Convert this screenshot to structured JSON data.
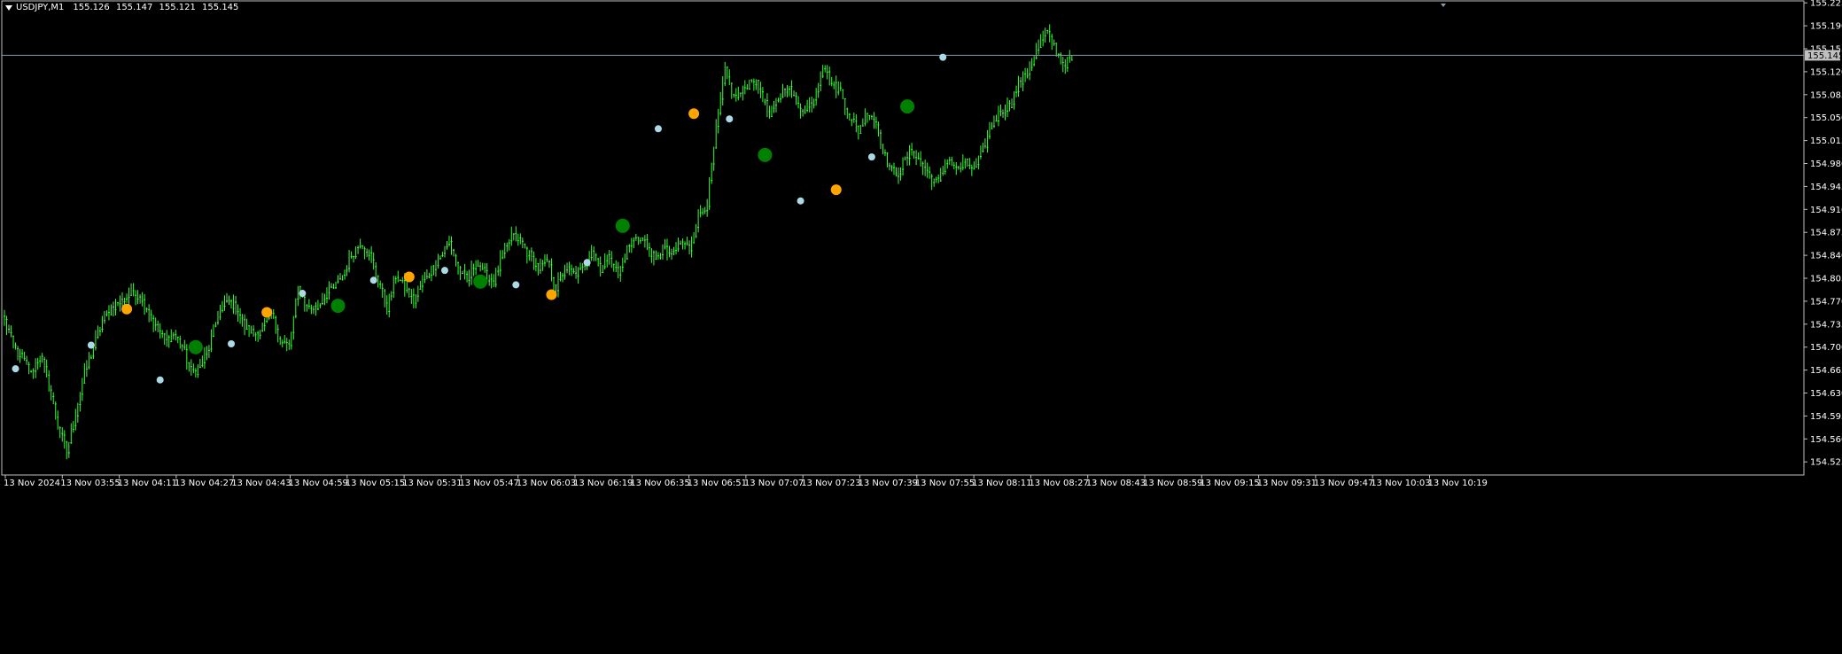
{
  "window": {
    "symbol_timeframe": "USDJPY,M1",
    "ohlc": [
      "155.126",
      "155.147",
      "155.121",
      "155.145"
    ]
  },
  "colors": {
    "background": "#000000",
    "candle": "#33ff33",
    "grid_frame": "#c0c0c0",
    "price_line": "#8899aa",
    "dot_light_blue": "#add8e6",
    "dot_orange": "#ffa500",
    "dot_green": "#008000"
  },
  "chart_data": {
    "type": "candlestick",
    "title": "",
    "xlabel": "",
    "ylabel": "",
    "ylim": [
      154.505,
      155.228
    ],
    "y_ticks": [
      "155.225",
      "155.190",
      "155.155",
      "155.120",
      "155.085",
      "155.050",
      "155.015",
      "154.980",
      "154.945",
      "154.910",
      "154.875",
      "154.840",
      "154.805",
      "154.770",
      "154.735",
      "154.700",
      "154.665",
      "154.630",
      "154.595",
      "154.560",
      "154.525"
    ],
    "current_price": "155.145",
    "x_ticks": [
      "13 Nov 2024",
      "13 Nov 03:55",
      "13 Nov 04:11",
      "13 Nov 04:27",
      "13 Nov 04:43",
      "13 Nov 04:59",
      "13 Nov 05:15",
      "13 Nov 05:31",
      "13 Nov 05:47",
      "13 Nov 06:03",
      "13 Nov 06:19",
      "13 Nov 06:35",
      "13 Nov 06:51",
      "13 Nov 07:07",
      "13 Nov 07:23",
      "13 Nov 07:39",
      "13 Nov 07:55",
      "13 Nov 08:11",
      "13 Nov 08:27",
      "13 Nov 08:43",
      "13 Nov 08:59",
      "13 Nov 09:15",
      "13 Nov 09:31",
      "13 Nov 09:47",
      "13 Nov 10:03",
      "13 Nov 10:19"
    ],
    "close_path": [
      [
        0,
        154.74
      ],
      [
        4,
        154.7
      ],
      [
        8,
        154.68
      ],
      [
        12,
        154.66
      ],
      [
        16,
        154.69
      ],
      [
        20,
        154.64
      ],
      [
        24,
        154.58
      ],
      [
        28,
        154.54
      ],
      [
        32,
        154.6
      ],
      [
        36,
        154.66
      ],
      [
        40,
        154.7
      ],
      [
        44,
        154.74
      ],
      [
        48,
        154.76
      ],
      [
        52,
        154.77
      ],
      [
        56,
        154.78
      ],
      [
        60,
        154.78
      ],
      [
        64,
        154.76
      ],
      [
        68,
        154.73
      ],
      [
        72,
        154.71
      ],
      [
        76,
        154.72
      ],
      [
        80,
        154.7
      ],
      [
        84,
        154.66
      ],
      [
        88,
        154.67
      ],
      [
        92,
        154.7
      ],
      [
        96,
        154.75
      ],
      [
        100,
        154.77
      ],
      [
        104,
        154.76
      ],
      [
        108,
        154.73
      ],
      [
        112,
        154.72
      ],
      [
        116,
        154.73
      ],
      [
        120,
        154.75
      ],
      [
        124,
        154.71
      ],
      [
        128,
        154.7
      ],
      [
        132,
        154.79
      ],
      [
        136,
        154.76
      ],
      [
        140,
        154.76
      ],
      [
        144,
        154.78
      ],
      [
        148,
        154.79
      ],
      [
        152,
        154.81
      ],
      [
        156,
        154.84
      ],
      [
        160,
        154.86
      ],
      [
        164,
        154.84
      ],
      [
        168,
        154.8
      ],
      [
        172,
        154.76
      ],
      [
        176,
        154.81
      ],
      [
        180,
        154.79
      ],
      [
        184,
        154.77
      ],
      [
        188,
        154.8
      ],
      [
        192,
        154.82
      ],
      [
        196,
        154.84
      ],
      [
        200,
        154.86
      ],
      [
        204,
        154.82
      ],
      [
        208,
        154.8
      ],
      [
        212,
        154.83
      ],
      [
        216,
        154.81
      ],
      [
        220,
        154.8
      ],
      [
        224,
        154.84
      ],
      [
        228,
        154.87
      ],
      [
        232,
        154.86
      ],
      [
        236,
        154.84
      ],
      [
        240,
        154.82
      ],
      [
        244,
        154.83
      ],
      [
        248,
        154.79
      ],
      [
        252,
        154.82
      ],
      [
        256,
        154.81
      ],
      [
        260,
        154.82
      ],
      [
        264,
        154.85
      ],
      [
        268,
        154.82
      ],
      [
        272,
        154.84
      ],
      [
        276,
        154.81
      ],
      [
        280,
        154.85
      ],
      [
        284,
        154.87
      ],
      [
        288,
        154.86
      ],
      [
        292,
        154.83
      ],
      [
        296,
        154.85
      ],
      [
        300,
        154.84
      ],
      [
        304,
        154.86
      ],
      [
        308,
        154.85
      ],
      [
        312,
        154.9
      ],
      [
        316,
        154.92
      ],
      [
        320,
        155.03
      ],
      [
        324,
        155.12
      ],
      [
        328,
        155.08
      ],
      [
        332,
        155.09
      ],
      [
        336,
        155.11
      ],
      [
        340,
        155.09
      ],
      [
        344,
        155.05
      ],
      [
        348,
        155.08
      ],
      [
        352,
        155.1
      ],
      [
        356,
        155.07
      ],
      [
        360,
        155.06
      ],
      [
        364,
        155.08
      ],
      [
        368,
        155.13
      ],
      [
        372,
        155.1
      ],
      [
        376,
        155.09
      ],
      [
        380,
        155.05
      ],
      [
        384,
        155.03
      ],
      [
        388,
        155.06
      ],
      [
        392,
        155.04
      ],
      [
        396,
        154.99
      ],
      [
        400,
        154.96
      ],
      [
        404,
        154.98
      ],
      [
        408,
        155.0
      ],
      [
        412,
        154.98
      ],
      [
        416,
        154.96
      ],
      [
        420,
        154.95
      ],
      [
        424,
        154.99
      ],
      [
        428,
        154.97
      ],
      [
        432,
        154.98
      ],
      [
        436,
        154.97
      ],
      [
        440,
        155.0
      ],
      [
        444,
        155.04
      ],
      [
        448,
        155.06
      ],
      [
        452,
        155.07
      ],
      [
        456,
        155.1
      ],
      [
        460,
        155.12
      ],
      [
        464,
        155.15
      ],
      [
        468,
        155.18
      ],
      [
        472,
        155.16
      ],
      [
        476,
        155.13
      ],
      [
        480,
        155.14
      ]
    ],
    "dots": [
      {
        "i": 5,
        "y": 154.667,
        "color": "dot_light_blue",
        "size": "small"
      },
      {
        "i": 39,
        "y": 154.703,
        "color": "dot_light_blue",
        "size": "small"
      },
      {
        "i": 55,
        "y": 154.758,
        "color": "dot_orange",
        "size": "medium"
      },
      {
        "i": 70,
        "y": 154.65,
        "color": "dot_light_blue",
        "size": "small"
      },
      {
        "i": 86,
        "y": 154.7,
        "color": "dot_green",
        "size": "large"
      },
      {
        "i": 102,
        "y": 154.705,
        "color": "dot_light_blue",
        "size": "small"
      },
      {
        "i": 118,
        "y": 154.753,
        "color": "dot_orange",
        "size": "medium"
      },
      {
        "i": 134,
        "y": 154.782,
        "color": "dot_light_blue",
        "size": "small"
      },
      {
        "i": 150,
        "y": 154.763,
        "color": "dot_green",
        "size": "large"
      },
      {
        "i": 166,
        "y": 154.802,
        "color": "dot_light_blue",
        "size": "small"
      },
      {
        "i": 182,
        "y": 154.807,
        "color": "dot_orange",
        "size": "medium"
      },
      {
        "i": 198,
        "y": 154.817,
        "color": "dot_light_blue",
        "size": "small"
      },
      {
        "i": 214,
        "y": 154.8,
        "color": "dot_green",
        "size": "large"
      },
      {
        "i": 230,
        "y": 154.795,
        "color": "dot_light_blue",
        "size": "small"
      },
      {
        "i": 246,
        "y": 154.78,
        "color": "dot_orange",
        "size": "medium"
      },
      {
        "i": 262,
        "y": 154.829,
        "color": "dot_light_blue",
        "size": "small"
      },
      {
        "i": 278,
        "y": 154.885,
        "color": "dot_green",
        "size": "large"
      },
      {
        "i": 294,
        "y": 155.033,
        "color": "dot_light_blue",
        "size": "small"
      },
      {
        "i": 310,
        "y": 155.056,
        "color": "dot_orange",
        "size": "medium"
      },
      {
        "i": 326,
        "y": 155.048,
        "color": "dot_light_blue",
        "size": "small"
      },
      {
        "i": 342,
        "y": 154.993,
        "color": "dot_green",
        "size": "large"
      },
      {
        "i": 358,
        "y": 154.923,
        "color": "dot_light_blue",
        "size": "small"
      },
      {
        "i": 374,
        "y": 154.94,
        "color": "dot_orange",
        "size": "medium"
      },
      {
        "i": 390,
        "y": 154.99,
        "color": "dot_light_blue",
        "size": "small"
      },
      {
        "i": 406,
        "y": 155.067,
        "color": "dot_green",
        "size": "large"
      },
      {
        "i": 422,
        "y": 155.142,
        "color": "dot_light_blue",
        "size": "small"
      }
    ]
  }
}
